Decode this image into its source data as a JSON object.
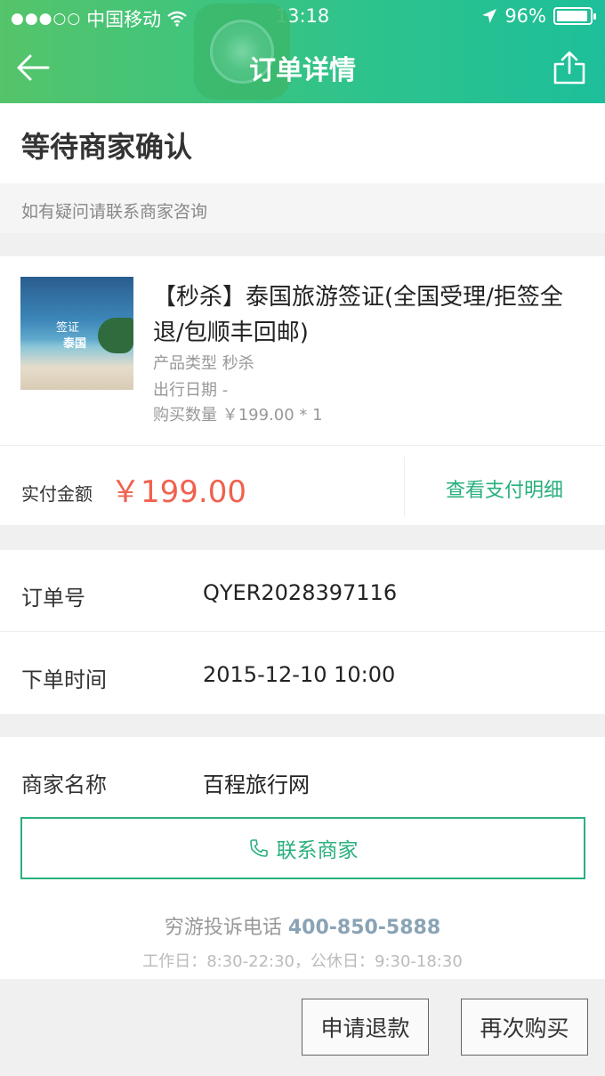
{
  "status_bar": {
    "signal_dots": "●●●○○",
    "carrier": "中国移动",
    "time": "13:18",
    "battery": "96%"
  },
  "nav": {
    "title": "订单详情"
  },
  "order_status": {
    "title": "等待商家确认",
    "hint": "如有疑问请联系商家咨询"
  },
  "product": {
    "image_text_1": "签证",
    "image_text_2": "泰国",
    "name": "【秒杀】泰国旅游签证(全国受理/拒签全退/包顺丰回邮)",
    "type_line": "产品类型 秒杀",
    "date_line": "出行日期 -",
    "qty_line": "购买数量 ￥199.00 * 1"
  },
  "payment": {
    "label": "实付金额",
    "amount": "￥199.00",
    "detail_link": "查看支付明细"
  },
  "order_info": {
    "number_label": "订单号",
    "number_value": "QYER2028397116",
    "time_label": "下单时间",
    "time_value": "2015-12-10 10:00"
  },
  "merchant": {
    "label": "商家名称",
    "name": "百程旅行网",
    "contact_button": "联系商家",
    "complaint_label": "穷游投诉电话",
    "complaint_phone": "400-850-5888",
    "hours": "工作日：8:30-22:30，公休日：9:30-18:30"
  },
  "actions": {
    "refund": "申请退款",
    "rebuy": "再次购买"
  },
  "colors": {
    "accent": "#2bb07e",
    "price": "#f0614e",
    "header_start": "#55c46a",
    "header_end": "#1dbf9a"
  }
}
